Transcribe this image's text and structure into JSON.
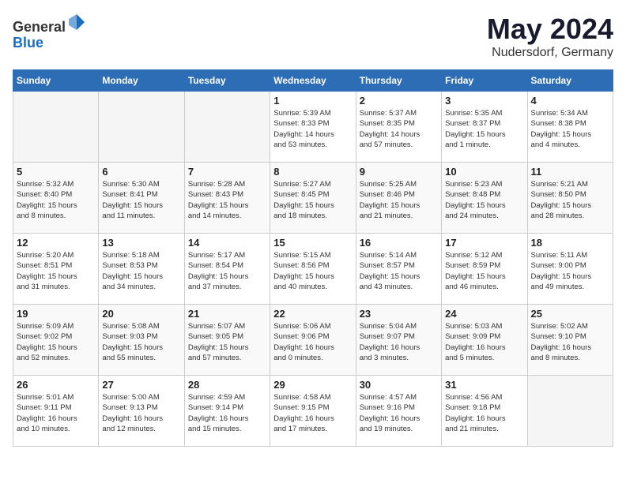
{
  "header": {
    "logo_line1": "General",
    "logo_line2": "Blue",
    "month_title": "May 2024",
    "location": "Nudersdorf, Germany"
  },
  "weekdays": [
    "Sunday",
    "Monday",
    "Tuesday",
    "Wednesday",
    "Thursday",
    "Friday",
    "Saturday"
  ],
  "weeks": [
    [
      {
        "day": "",
        "info": ""
      },
      {
        "day": "",
        "info": ""
      },
      {
        "day": "",
        "info": ""
      },
      {
        "day": "1",
        "info": "Sunrise: 5:39 AM\nSunset: 8:33 PM\nDaylight: 14 hours\nand 53 minutes."
      },
      {
        "day": "2",
        "info": "Sunrise: 5:37 AM\nSunset: 8:35 PM\nDaylight: 14 hours\nand 57 minutes."
      },
      {
        "day": "3",
        "info": "Sunrise: 5:35 AM\nSunset: 8:37 PM\nDaylight: 15 hours\nand 1 minute."
      },
      {
        "day": "4",
        "info": "Sunrise: 5:34 AM\nSunset: 8:38 PM\nDaylight: 15 hours\nand 4 minutes."
      }
    ],
    [
      {
        "day": "5",
        "info": "Sunrise: 5:32 AM\nSunset: 8:40 PM\nDaylight: 15 hours\nand 8 minutes."
      },
      {
        "day": "6",
        "info": "Sunrise: 5:30 AM\nSunset: 8:41 PM\nDaylight: 15 hours\nand 11 minutes."
      },
      {
        "day": "7",
        "info": "Sunrise: 5:28 AM\nSunset: 8:43 PM\nDaylight: 15 hours\nand 14 minutes."
      },
      {
        "day": "8",
        "info": "Sunrise: 5:27 AM\nSunset: 8:45 PM\nDaylight: 15 hours\nand 18 minutes."
      },
      {
        "day": "9",
        "info": "Sunrise: 5:25 AM\nSunset: 8:46 PM\nDaylight: 15 hours\nand 21 minutes."
      },
      {
        "day": "10",
        "info": "Sunrise: 5:23 AM\nSunset: 8:48 PM\nDaylight: 15 hours\nand 24 minutes."
      },
      {
        "day": "11",
        "info": "Sunrise: 5:21 AM\nSunset: 8:50 PM\nDaylight: 15 hours\nand 28 minutes."
      }
    ],
    [
      {
        "day": "12",
        "info": "Sunrise: 5:20 AM\nSunset: 8:51 PM\nDaylight: 15 hours\nand 31 minutes."
      },
      {
        "day": "13",
        "info": "Sunrise: 5:18 AM\nSunset: 8:53 PM\nDaylight: 15 hours\nand 34 minutes."
      },
      {
        "day": "14",
        "info": "Sunrise: 5:17 AM\nSunset: 8:54 PM\nDaylight: 15 hours\nand 37 minutes."
      },
      {
        "day": "15",
        "info": "Sunrise: 5:15 AM\nSunset: 8:56 PM\nDaylight: 15 hours\nand 40 minutes."
      },
      {
        "day": "16",
        "info": "Sunrise: 5:14 AM\nSunset: 8:57 PM\nDaylight: 15 hours\nand 43 minutes."
      },
      {
        "day": "17",
        "info": "Sunrise: 5:12 AM\nSunset: 8:59 PM\nDaylight: 15 hours\nand 46 minutes."
      },
      {
        "day": "18",
        "info": "Sunrise: 5:11 AM\nSunset: 9:00 PM\nDaylight: 15 hours\nand 49 minutes."
      }
    ],
    [
      {
        "day": "19",
        "info": "Sunrise: 5:09 AM\nSunset: 9:02 PM\nDaylight: 15 hours\nand 52 minutes."
      },
      {
        "day": "20",
        "info": "Sunrise: 5:08 AM\nSunset: 9:03 PM\nDaylight: 15 hours\nand 55 minutes."
      },
      {
        "day": "21",
        "info": "Sunrise: 5:07 AM\nSunset: 9:05 PM\nDaylight: 15 hours\nand 57 minutes."
      },
      {
        "day": "22",
        "info": "Sunrise: 5:06 AM\nSunset: 9:06 PM\nDaylight: 16 hours\nand 0 minutes."
      },
      {
        "day": "23",
        "info": "Sunrise: 5:04 AM\nSunset: 9:07 PM\nDaylight: 16 hours\nand 3 minutes."
      },
      {
        "day": "24",
        "info": "Sunrise: 5:03 AM\nSunset: 9:09 PM\nDaylight: 16 hours\nand 5 minutes."
      },
      {
        "day": "25",
        "info": "Sunrise: 5:02 AM\nSunset: 9:10 PM\nDaylight: 16 hours\nand 8 minutes."
      }
    ],
    [
      {
        "day": "26",
        "info": "Sunrise: 5:01 AM\nSunset: 9:11 PM\nDaylight: 16 hours\nand 10 minutes."
      },
      {
        "day": "27",
        "info": "Sunrise: 5:00 AM\nSunset: 9:13 PM\nDaylight: 16 hours\nand 12 minutes."
      },
      {
        "day": "28",
        "info": "Sunrise: 4:59 AM\nSunset: 9:14 PM\nDaylight: 16 hours\nand 15 minutes."
      },
      {
        "day": "29",
        "info": "Sunrise: 4:58 AM\nSunset: 9:15 PM\nDaylight: 16 hours\nand 17 minutes."
      },
      {
        "day": "30",
        "info": "Sunrise: 4:57 AM\nSunset: 9:16 PM\nDaylight: 16 hours\nand 19 minutes."
      },
      {
        "day": "31",
        "info": "Sunrise: 4:56 AM\nSunset: 9:18 PM\nDaylight: 16 hours\nand 21 minutes."
      },
      {
        "day": "",
        "info": ""
      }
    ]
  ]
}
